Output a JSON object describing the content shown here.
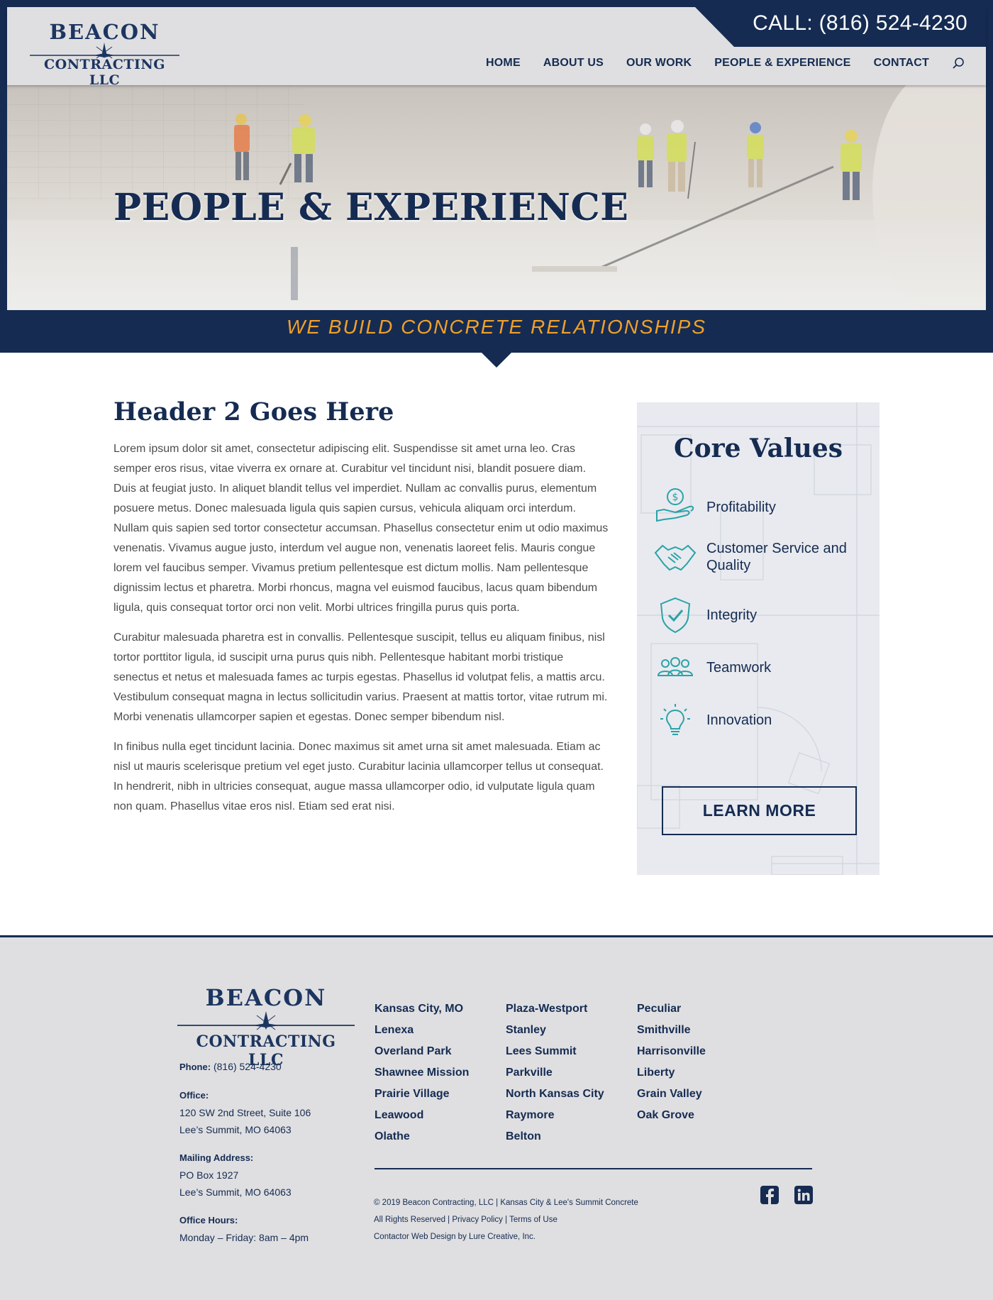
{
  "header": {
    "logo_top": "BEACON",
    "logo_bottom": "CONTRACTING LLC",
    "call": "CALL: (816) 524-4230",
    "nav": [
      "HOME",
      "ABOUT US",
      "OUR WORK",
      "PEOPLE & EXPERIENCE",
      "CONTACT"
    ],
    "search_icon": "search-icon"
  },
  "hero": {
    "title": "PEOPLE & EXPERIENCE",
    "tagline": "WE BUILD CONCRETE RELATIONSHIPS"
  },
  "main": {
    "heading": "Header 2 Goes Here",
    "paragraphs": [
      "Lorem ipsum dolor sit amet, consectetur adipiscing elit. Suspendisse sit amet urna leo. Cras semper eros risus, vitae viverra ex ornare at. Curabitur vel tincidunt nisi, blandit posuere diam. Duis at feugiat justo. In aliquet blandit tellus vel imperdiet. Nullam ac convallis purus, elementum posuere metus. Donec malesuada ligula quis sapien cursus, vehicula aliquam orci interdum. Nullam quis sapien sed tortor consectetur accumsan. Phasellus consectetur enim ut odio maximus venenatis. Vivamus augue justo, interdum vel augue non, venenatis laoreet felis. Mauris congue lorem vel faucibus semper. Vivamus pretium pellentesque est dictum mollis. Nam pellentesque dignissim lectus et pharetra. Morbi rhoncus, magna vel euismod faucibus, lacus quam bibendum ligula, quis consequat tortor orci non velit. Morbi ultrices fringilla purus quis porta.",
      "Curabitur malesuada pharetra est in convallis. Pellentesque suscipit, tellus eu aliquam finibus, nisl tortor porttitor ligula, id suscipit urna purus quis nibh. Pellentesque habitant morbi tristique senectus et netus et malesuada fames ac turpis egestas. Phasellus id volutpat felis, a mattis arcu. Vestibulum consequat magna in lectus sollicitudin varius. Praesent at mattis tortor, vitae rutrum mi. Morbi venenatis ullamcorper sapien et egestas. Donec semper bibendum nisl.",
      "In finibus nulla eget tincidunt lacinia. Donec maximus sit amet urna sit amet malesuada. Etiam ac nisl ut mauris scelerisque pretium vel eget justo. Curabitur lacinia ullamcorper tellus ut consequat. In hendrerit, nibh in ultricies consequat, augue massa ullamcorper odio, id vulputate ligula quam non quam. Phasellus vitae eros nisl. Etiam sed erat nisi."
    ]
  },
  "core_values": {
    "title": "Core Values",
    "items": [
      {
        "label": "Profitability",
        "icon": "money-hand-icon"
      },
      {
        "label": "Customer Service and Quality",
        "icon": "handshake-icon"
      },
      {
        "label": "Integrity",
        "icon": "shield-check-icon"
      },
      {
        "label": "Teamwork",
        "icon": "team-icon"
      },
      {
        "label": "Innovation",
        "icon": "lightbulb-icon"
      }
    ],
    "button": "LEARN MORE"
  },
  "footer": {
    "logo_top": "BEACON",
    "logo_bottom": "CONTRACTING LLC",
    "phone_label": "Phone:",
    "phone": "(816) 524-4230",
    "office_label": "Office:",
    "office_line1": "120 SW 2nd Street, Suite 106",
    "office_line2": "Lee’s Summit, MO 64063",
    "mailing_label": "Mailing Address:",
    "mailing_line1": "PO Box 1927",
    "mailing_line2": "Lee’s Summit, MO 64063",
    "hours_label": "Office Hours:",
    "hours": "Monday – Friday: 8am – 4pm",
    "locations": [
      [
        "Kansas City, MO",
        "Lenexa",
        "Overland Park",
        "Shawnee Mission",
        "Prairie Village",
        "Leawood",
        "Olathe"
      ],
      [
        "Plaza-Westport",
        "Stanley",
        "Lees Summit",
        "Parkville",
        "North Kansas City",
        "Raymore",
        "Belton"
      ],
      [
        "Peculiar",
        "Smithville",
        "Harrisonville",
        "Liberty",
        "Grain Valley",
        "Oak Grove"
      ]
    ],
    "legal1": "© 2019 Beacon Contracting, LLC | Kansas City & Lee's Summit Concrete",
    "legal2": "All Rights Reserved | Privacy Policy | Terms of Use",
    "legal3": "Contactor Web Design by Lure Creative, Inc.",
    "social": [
      "facebook-icon",
      "linkedin-icon"
    ]
  },
  "colors": {
    "navy": "#152b52",
    "orange": "#f0a02a",
    "teal": "#2aa3a8",
    "gray_bg": "#dfdfe1"
  }
}
